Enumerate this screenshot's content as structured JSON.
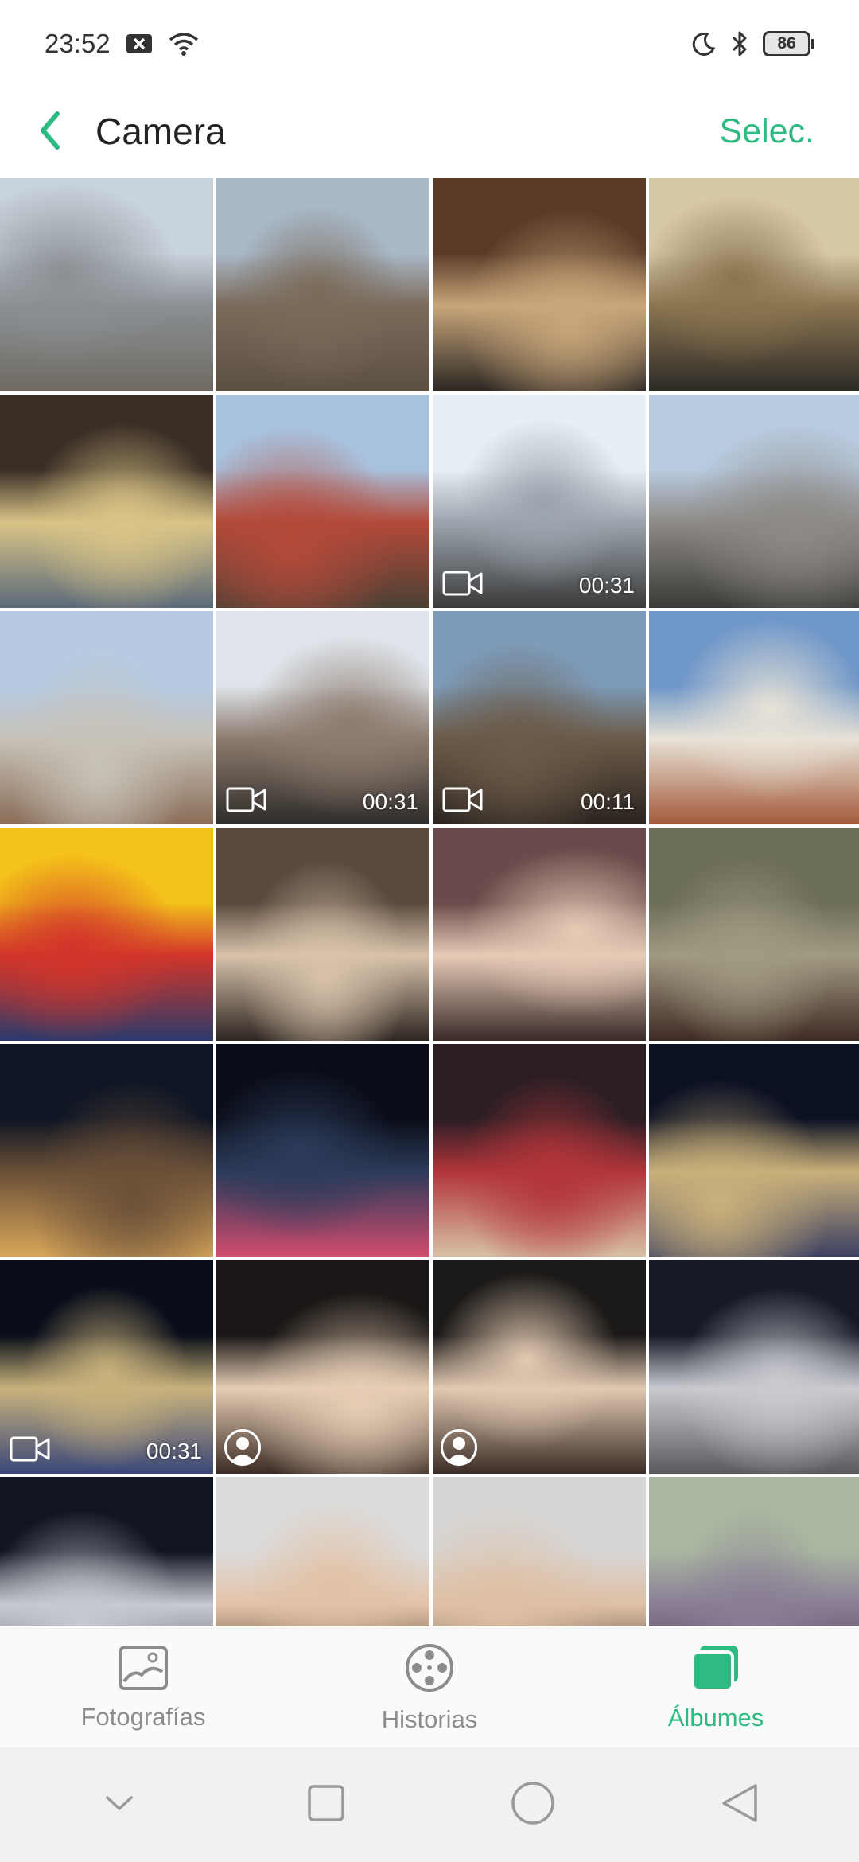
{
  "status_bar": {
    "time": "23:52",
    "icons": [
      "notification-dismiss-icon",
      "wifi-icon"
    ],
    "right_icons": [
      "moon-icon",
      "bluetooth-icon"
    ],
    "battery": "86"
  },
  "header": {
    "back_icon": "chevron-left-icon",
    "title": "Camera",
    "select_label": "Selec.",
    "accent": "#2dbb82"
  },
  "grid": {
    "items": [
      {
        "kind": "photo"
      },
      {
        "kind": "photo"
      },
      {
        "kind": "photo"
      },
      {
        "kind": "photo"
      },
      {
        "kind": "photo"
      },
      {
        "kind": "photo"
      },
      {
        "kind": "video",
        "duration": "00:31"
      },
      {
        "kind": "photo"
      },
      {
        "kind": "photo"
      },
      {
        "kind": "video",
        "duration": "00:31"
      },
      {
        "kind": "video",
        "duration": "00:11"
      },
      {
        "kind": "photo"
      },
      {
        "kind": "photo"
      },
      {
        "kind": "photo"
      },
      {
        "kind": "photo"
      },
      {
        "kind": "photo"
      },
      {
        "kind": "photo"
      },
      {
        "kind": "photo"
      },
      {
        "kind": "photo"
      },
      {
        "kind": "photo"
      },
      {
        "kind": "video",
        "duration": "00:31"
      },
      {
        "kind": "portrait"
      },
      {
        "kind": "portrait"
      },
      {
        "kind": "photo"
      },
      {
        "kind": "photo"
      },
      {
        "kind": "photo"
      },
      {
        "kind": "photo"
      },
      {
        "kind": "portrait"
      }
    ]
  },
  "tabs": [
    {
      "label": "Fotografías",
      "icon": "photo-icon",
      "active": false
    },
    {
      "label": "Historias",
      "icon": "film-reel-icon",
      "active": false
    },
    {
      "label": "Álbumes",
      "icon": "albums-icon",
      "active": true
    }
  ],
  "nav": {
    "buttons": [
      "collapse-chevron-icon",
      "recents-square-icon",
      "home-circle-icon",
      "back-triangle-icon"
    ]
  }
}
